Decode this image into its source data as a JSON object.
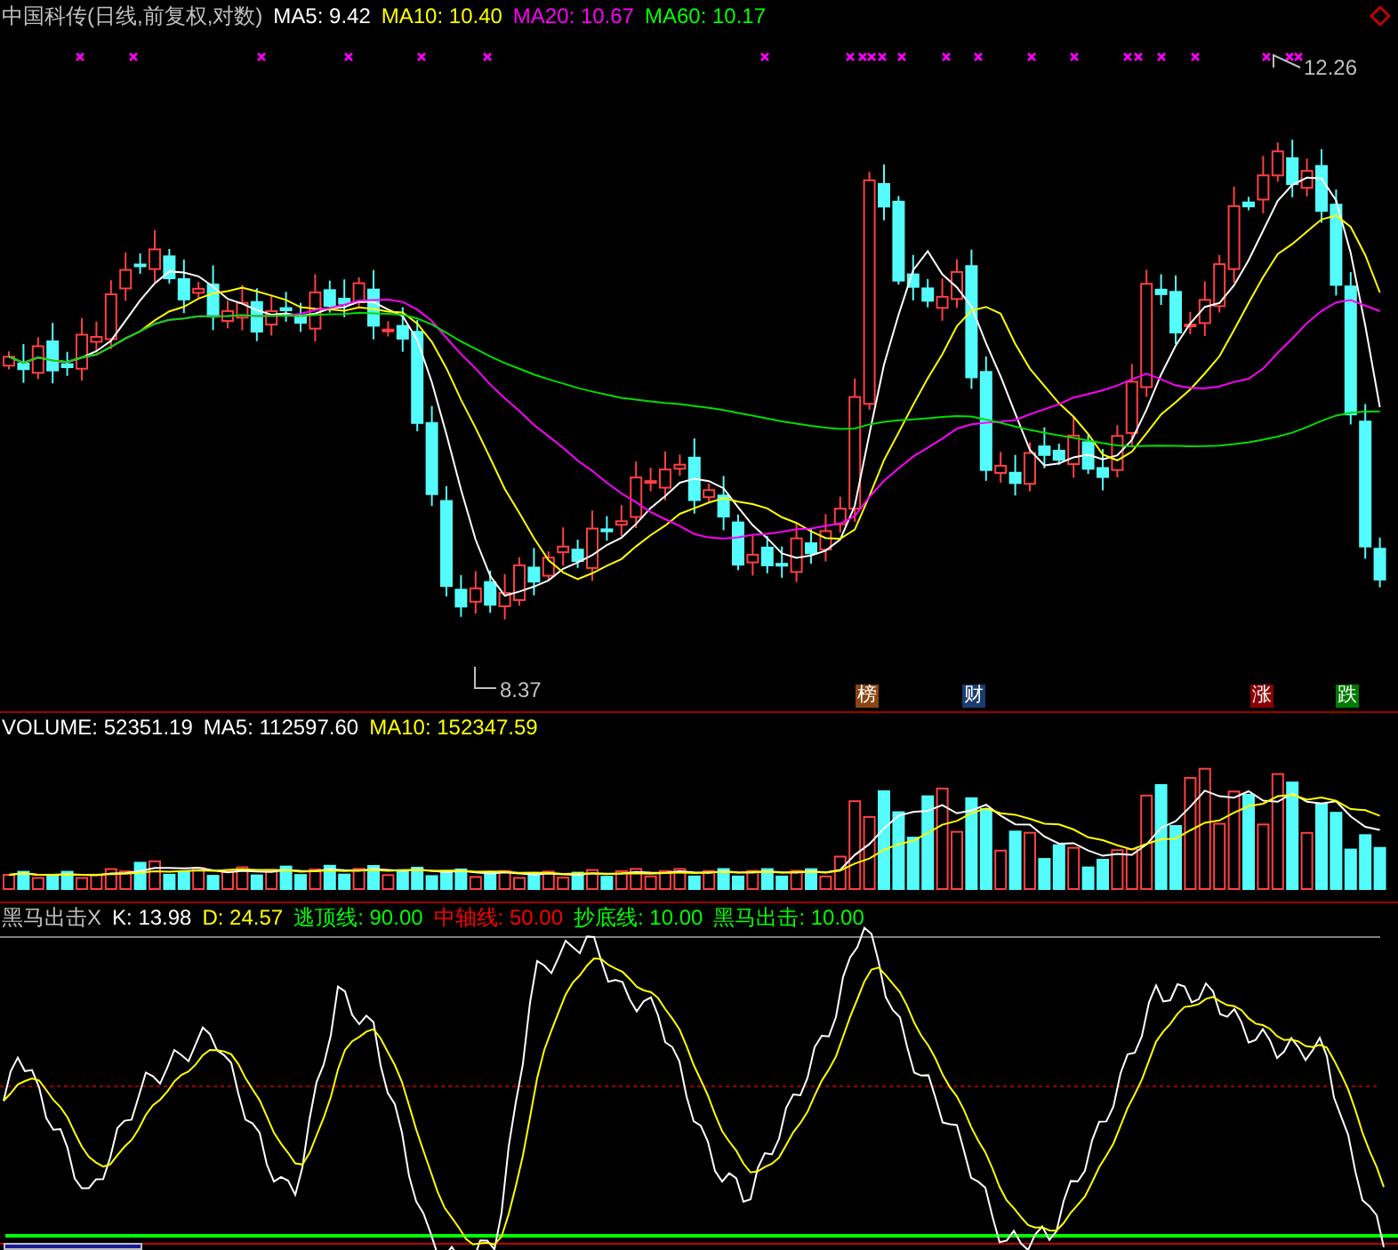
{
  "main_panel": {
    "title": "中国科传(日线,前复权,对数)",
    "legend": [
      {
        "label": "MA5: 9.42",
        "color": "#ffffff"
      },
      {
        "label": "MA10: 10.40",
        "color": "#ffff00"
      },
      {
        "label": "MA20: 10.67",
        "color": "#ff00ff"
      },
      {
        "label": "MA60: 10.17",
        "color": "#00ff00"
      }
    ],
    "high_label": "12.26",
    "low_label": "8.37",
    "event_tags": [
      {
        "label": "榜",
        "color": "#8b4513"
      },
      {
        "label": "财",
        "color": "#1a3d6e"
      },
      {
        "label": "涨",
        "color": "#8b0000"
      },
      {
        "label": "跌",
        "color": "#007a00"
      }
    ]
  },
  "volume_panel": {
    "legend": [
      {
        "label": "VOLUME: 52351.19",
        "color": "#ffffff"
      },
      {
        "label": "MA5: 112597.60",
        "color": "#ffffff"
      },
      {
        "label": "MA10: 152347.59",
        "color": "#ffff00"
      }
    ]
  },
  "indicator_panel": {
    "legend": [
      {
        "label": "黑马出击X",
        "color": "#c0c0c0"
      },
      {
        "label": "K: 13.98",
        "color": "#ffffff"
      },
      {
        "label": "D: 24.57",
        "color": "#ffff00"
      },
      {
        "label": "逃顶线: 90.00",
        "color": "#00ff00"
      },
      {
        "label": "中轴线: 50.00",
        "color": "#ff0000"
      },
      {
        "label": "抄底线: 10.00",
        "color": "#00ff00"
      },
      {
        "label": "黑马出击: 10.00",
        "color": "#00ff00"
      }
    ]
  }
}
